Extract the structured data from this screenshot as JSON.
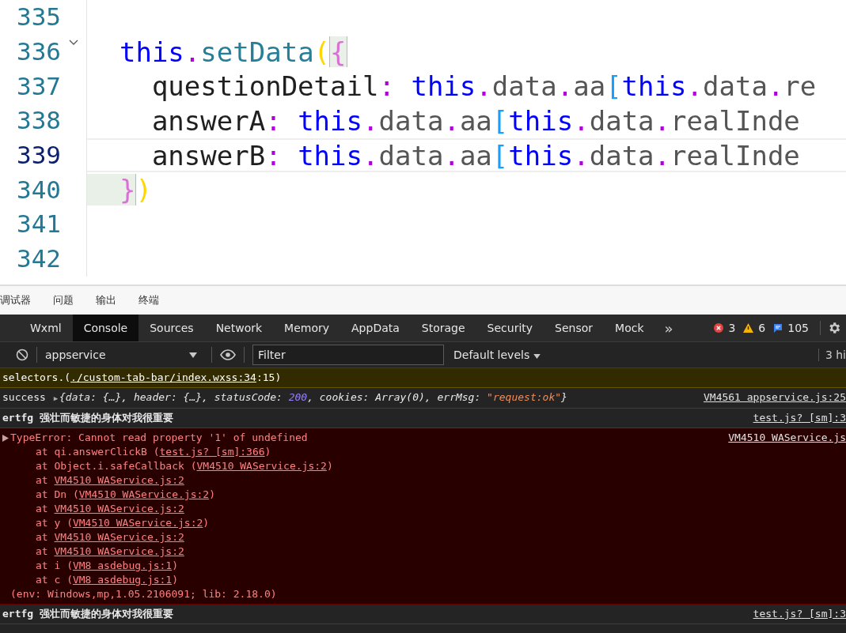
{
  "editor": {
    "lines": [
      {
        "number": "335",
        "current": false,
        "foldable": false
      },
      {
        "number": "336",
        "current": false,
        "foldable": true,
        "tokens": [
          {
            "text": "  this",
            "kind": "keyword"
          },
          {
            "text": ".",
            "kind": "punctuation"
          },
          {
            "text": "setData",
            "kind": "function"
          },
          {
            "text": "(",
            "kind": "bracket1"
          },
          {
            "text": "{",
            "kind": "bracket2-match"
          }
        ]
      },
      {
        "number": "337",
        "current": false,
        "foldable": false,
        "tokens": [
          {
            "text": "    questionDetail",
            "kind": "identifier"
          },
          {
            "text": ": ",
            "kind": "punctuation"
          },
          {
            "text": "this",
            "kind": "keyword"
          },
          {
            "text": ".",
            "kind": "punctuation"
          },
          {
            "text": "data",
            "kind": "property"
          },
          {
            "text": ".",
            "kind": "punctuation"
          },
          {
            "text": "aa",
            "kind": "property"
          },
          {
            "text": "[",
            "kind": "bracket3"
          },
          {
            "text": "this",
            "kind": "keyword"
          },
          {
            "text": ".",
            "kind": "punctuation"
          },
          {
            "text": "data",
            "kind": "property"
          },
          {
            "text": ".",
            "kind": "punctuation"
          },
          {
            "text": "re",
            "kind": "property"
          }
        ]
      },
      {
        "number": "338",
        "current": false,
        "foldable": false,
        "tokens": [
          {
            "text": "    answerA",
            "kind": "identifier"
          },
          {
            "text": ": ",
            "kind": "punctuation"
          },
          {
            "text": "this",
            "kind": "keyword"
          },
          {
            "text": ".",
            "kind": "punctuation"
          },
          {
            "text": "data",
            "kind": "property"
          },
          {
            "text": ".",
            "kind": "punctuation"
          },
          {
            "text": "aa",
            "kind": "property"
          },
          {
            "text": "[",
            "kind": "bracket3"
          },
          {
            "text": "this",
            "kind": "keyword"
          },
          {
            "text": ".",
            "kind": "punctuation"
          },
          {
            "text": "data",
            "kind": "property"
          },
          {
            "text": ".",
            "kind": "punctuation"
          },
          {
            "text": "realInde",
            "kind": "property"
          }
        ]
      },
      {
        "number": "339",
        "current": true,
        "foldable": false,
        "tokens": [
          {
            "text": "    answerB",
            "kind": "identifier"
          },
          {
            "text": ": ",
            "kind": "punctuation"
          },
          {
            "text": "this",
            "kind": "keyword"
          },
          {
            "text": ".",
            "kind": "punctuation"
          },
          {
            "text": "data",
            "kind": "property"
          },
          {
            "text": ".",
            "kind": "punctuation"
          },
          {
            "text": "aa",
            "kind": "property"
          },
          {
            "text": "[",
            "kind": "bracket3"
          },
          {
            "text": "this",
            "kind": "keyword"
          },
          {
            "text": ".",
            "kind": "punctuation"
          },
          {
            "text": "data",
            "kind": "property"
          },
          {
            "text": ".",
            "kind": "punctuation"
          },
          {
            "text": "realInde",
            "kind": "property"
          }
        ]
      },
      {
        "number": "340",
        "current": false,
        "foldable": false,
        "tokens": [
          {
            "text": "  }",
            "kind": "bracket2-match"
          },
          {
            "text": ")",
            "kind": "bracket1"
          }
        ]
      },
      {
        "number": "341",
        "current": false,
        "foldable": false
      },
      {
        "number": "342",
        "current": false,
        "foldable": false
      }
    ]
  },
  "panel_tabs": [
    "调试器",
    "问题",
    "输出",
    "终端"
  ],
  "devtools": {
    "tabs": [
      {
        "label": "Wxml",
        "selected": false
      },
      {
        "label": "Console",
        "selected": true
      },
      {
        "label": "Sources",
        "selected": false
      },
      {
        "label": "Network",
        "selected": false
      },
      {
        "label": "Memory",
        "selected": false
      },
      {
        "label": "AppData",
        "selected": false
      },
      {
        "label": "Storage",
        "selected": false
      },
      {
        "label": "Security",
        "selected": false
      },
      {
        "label": "Sensor",
        "selected": false
      },
      {
        "label": "Mock",
        "selected": false
      }
    ],
    "more": "»",
    "counters": [
      {
        "kind": "error",
        "count": "3"
      },
      {
        "kind": "warning",
        "count": "6"
      },
      {
        "kind": "info",
        "count": "105"
      }
    ]
  },
  "toolbar": {
    "context": "appservice",
    "filter_placeholder": "Filter",
    "levels": "Default levels",
    "hidden": "3 hi"
  },
  "messages": [
    {
      "kind": "warning",
      "expandable": false,
      "lines": [
        {
          "kind": "plain",
          "parts": [
            {
              "text": "selectors.(",
              "kind": "text"
            },
            {
              "text": "./custom-tab-bar/index.wxss:34",
              "kind": "link"
            },
            {
              "text": ":15)",
              "kind": "text"
            }
          ]
        }
      ]
    },
    {
      "kind": "log",
      "expandable": false,
      "source": "VM4561 appservice.js:25",
      "lines": [
        {
          "kind": "object",
          "parts": [
            {
              "text": "success ",
              "kind": "text"
            },
            {
              "text": "▶",
              "kind": "arrow"
            },
            {
              "text": "{data: {…}, header: {…}, statusCode: ",
              "kind": "object"
            },
            {
              "text": "200",
              "kind": "number"
            },
            {
              "text": ", cookies: Array(0), errMsg: ",
              "kind": "object"
            },
            {
              "text": "\"request:ok\"",
              "kind": "string"
            },
            {
              "text": "}",
              "kind": "object"
            }
          ]
        }
      ]
    },
    {
      "kind": "log",
      "expandable": false,
      "source": "test.js? [sm]:3",
      "lines": [
        {
          "kind": "plain",
          "parts": [
            {
              "text": "ertfg 强壮而敏捷的身体对我很重要",
              "kind": "text"
            }
          ]
        }
      ]
    },
    {
      "kind": "error",
      "expandable": true,
      "source": "VM4510 WAService.js",
      "lines": [
        {
          "kind": "head",
          "parts": [
            {
              "text": "TypeError: Cannot read property '1' of undefined",
              "kind": "text"
            }
          ]
        },
        {
          "kind": "stack",
          "parts": [
            {
              "text": "at qi.answerClickB (",
              "kind": "text"
            },
            {
              "text": "test.js? [sm]:366",
              "kind": "link"
            },
            {
              "text": ")",
              "kind": "text"
            }
          ]
        },
        {
          "kind": "stack",
          "parts": [
            {
              "text": "at Object.i.safeCallback (",
              "kind": "text"
            },
            {
              "text": "VM4510 WAService.js:2",
              "kind": "link"
            },
            {
              "text": ")",
              "kind": "text"
            }
          ]
        },
        {
          "kind": "stack",
          "parts": [
            {
              "text": "at ",
              "kind": "text"
            },
            {
              "text": "VM4510 WAService.js:2",
              "kind": "link"
            }
          ]
        },
        {
          "kind": "stack",
          "parts": [
            {
              "text": "at Dn (",
              "kind": "text"
            },
            {
              "text": "VM4510 WAService.js:2",
              "kind": "link"
            },
            {
              "text": ")",
              "kind": "text"
            }
          ]
        },
        {
          "kind": "stack",
          "parts": [
            {
              "text": "at ",
              "kind": "text"
            },
            {
              "text": "VM4510 WAService.js:2",
              "kind": "link"
            }
          ]
        },
        {
          "kind": "stack",
          "parts": [
            {
              "text": "at y (",
              "kind": "text"
            },
            {
              "text": "VM4510 WAService.js:2",
              "kind": "link"
            },
            {
              "text": ")",
              "kind": "text"
            }
          ]
        },
        {
          "kind": "stack",
          "parts": [
            {
              "text": "at ",
              "kind": "text"
            },
            {
              "text": "VM4510 WAService.js:2",
              "kind": "link"
            }
          ]
        },
        {
          "kind": "stack",
          "parts": [
            {
              "text": "at ",
              "kind": "text"
            },
            {
              "text": "VM4510 WAService.js:2",
              "kind": "link"
            }
          ]
        },
        {
          "kind": "stack",
          "parts": [
            {
              "text": "at i (",
              "kind": "text"
            },
            {
              "text": "VM8 asdebug.js:1",
              "kind": "link"
            },
            {
              "text": ")",
              "kind": "text"
            }
          ]
        },
        {
          "kind": "stack",
          "parts": [
            {
              "text": "at c (",
              "kind": "text"
            },
            {
              "text": "VM8 asdebug.js:1",
              "kind": "link"
            },
            {
              "text": ")",
              "kind": "text"
            }
          ]
        },
        {
          "kind": "plain",
          "parts": [
            {
              "text": "(env: Windows,mp,1.05.2106091; lib: 2.18.0)",
              "kind": "text"
            }
          ]
        }
      ]
    },
    {
      "kind": "log",
      "expandable": false,
      "source": "test.js? [sm]:3",
      "lines": [
        {
          "kind": "plain",
          "parts": [
            {
              "text": "ertfg 强壮而敏捷的身体对我很重要",
              "kind": "text"
            }
          ]
        }
      ]
    }
  ]
}
